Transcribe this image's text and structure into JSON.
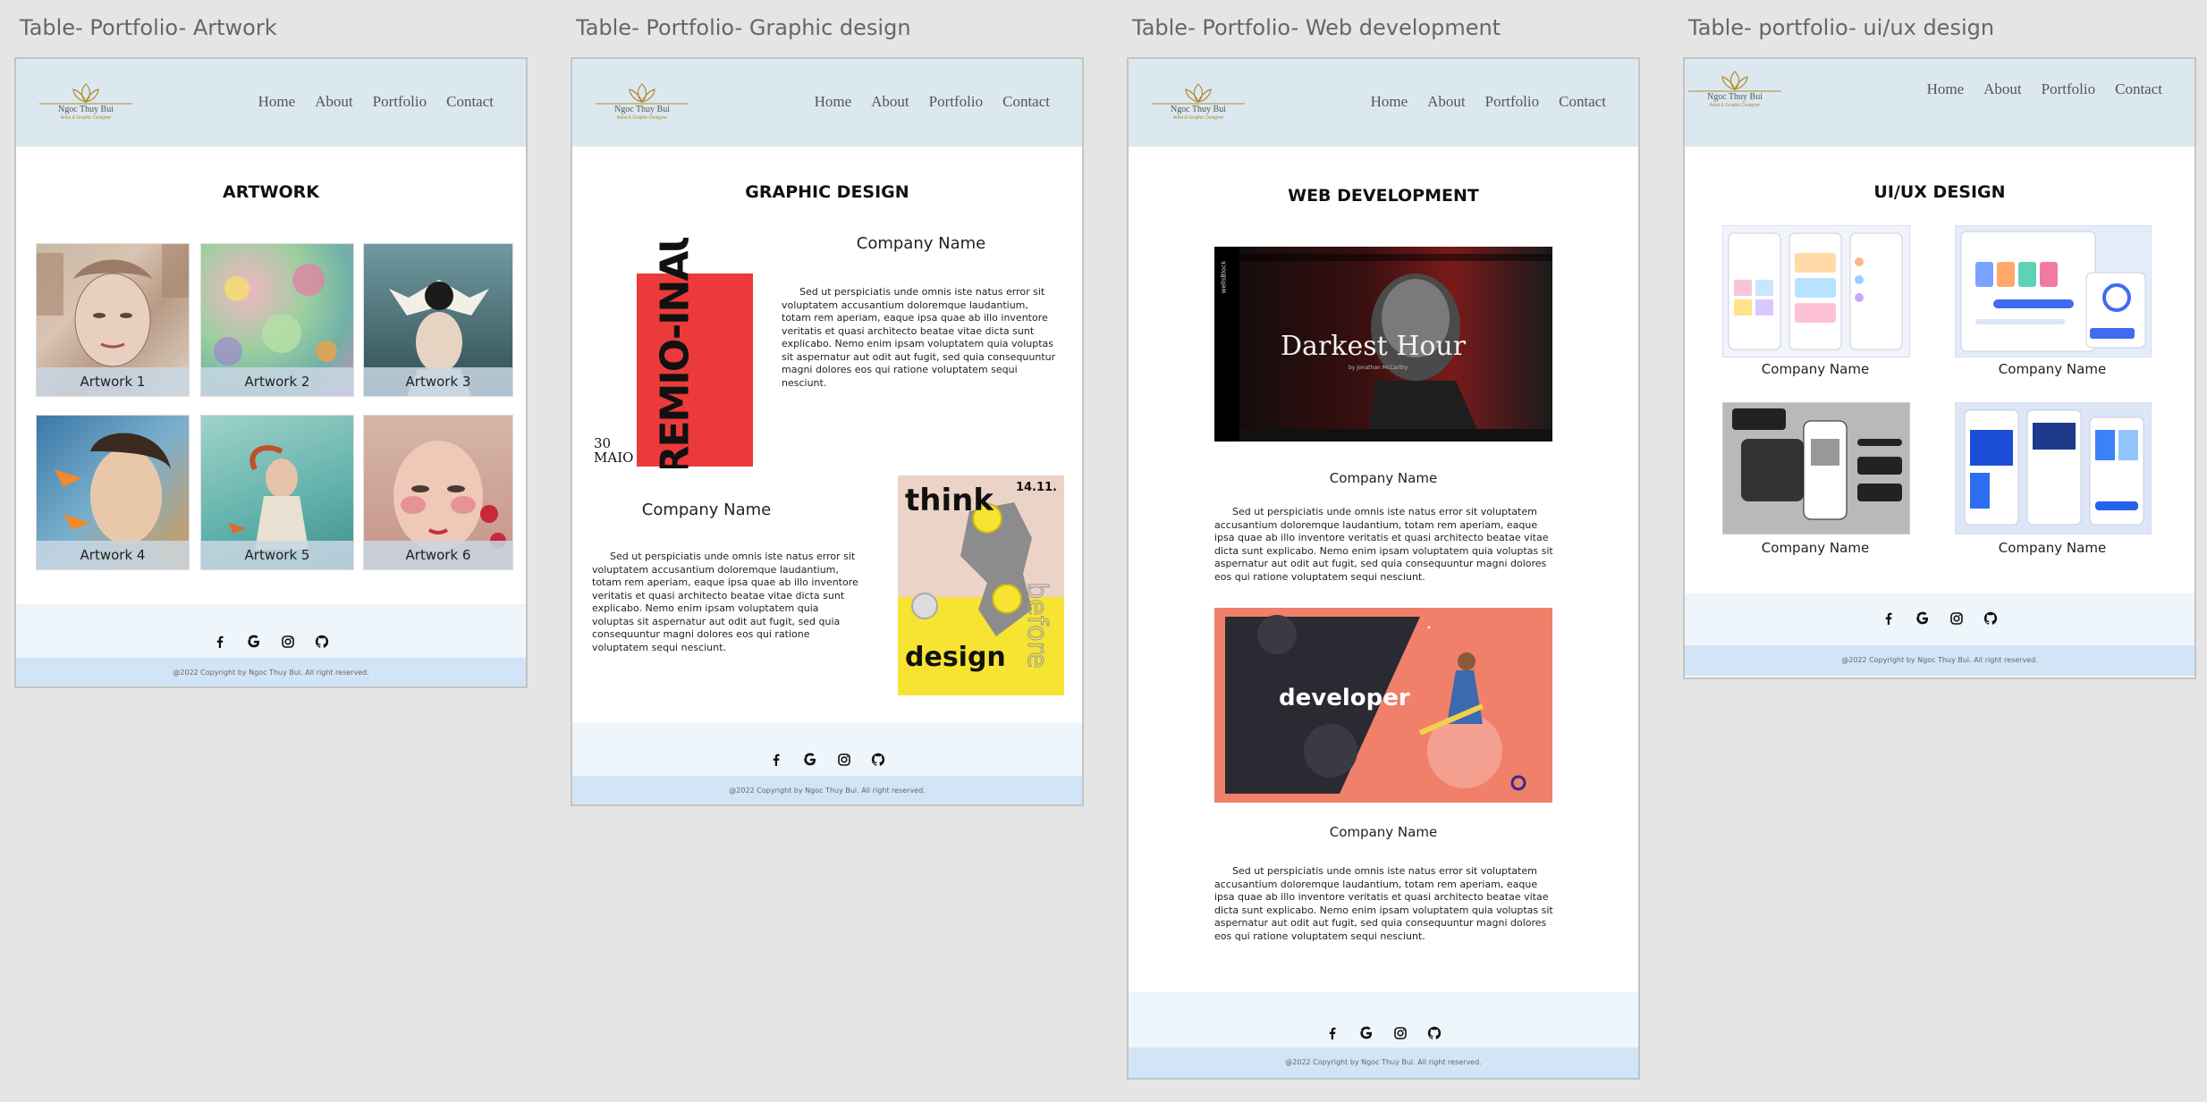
{
  "nav": [
    "Home",
    "About",
    "Portfolio",
    "Contact"
  ],
  "logo": {
    "name": "Ngoc Thuy Bui",
    "tagline": "Artist & Graphic Designer"
  },
  "copyright": "@2022 Copyright by Ngoc Thuy Bui. All right reserved.",
  "social_icons": [
    "facebook-icon",
    "google-icon",
    "instagram-icon",
    "github-icon"
  ],
  "colors": {
    "header_bg": "#dce8f0",
    "footer_bg": "#eef5fb",
    "copyright_bg": "#d2e5f6",
    "canvas_bg": "#e5e5e5"
  },
  "paragraph": "Sed ut perspiciatis unde omnis iste natus error sit voluptatem accusantium doloremque laudantium, totam rem aperiam, eaque ipsa quae ab illo inventore veritatis et quasi architecto beatae vitae dicta sunt explicabo. Nemo enim ipsam voluptatem quia voluptas sit aspernatur aut odit aut fugit, sed quia consequuntur magni dolores eos qui ratione voluptatem sequi nesciunt.",
  "frames": {
    "artwork": {
      "label": "Table- Portfolio- Artwork",
      "heading": "ARTWORK",
      "items": [
        "Artwork 1",
        "Artwork 2",
        "Artwork 3",
        "Artwork 4",
        "Artwork 5",
        "Artwork 6"
      ]
    },
    "graphic": {
      "label": "Table- Portfolio- Graphic design",
      "heading": "GRAPHIC DESIGN",
      "company1": "Company Name",
      "company2": "Company Name",
      "poster1": {
        "text": "GREMIO-INAUGURA",
        "date": "30 MAIO"
      },
      "poster2": {
        "top": "think",
        "bottom": "design",
        "side": "before",
        "date": "14.11."
      }
    },
    "web": {
      "label": "Table- Portfolio- Web development",
      "heading": "WEB DEVELOPMENT",
      "company1": "Company Name",
      "company2": "Company Name",
      "shot1": {
        "title": "Darkest Hour",
        "subtitle": "by Jonathan McCarthy",
        "side": "wellsBlock"
      },
      "shot2": {
        "title": "developer"
      }
    },
    "uiux": {
      "label": "Table- portfolio- ui/ux design",
      "heading": "UI/UX DESIGN",
      "items": [
        "Company Name",
        "Company Name",
        "Company Name",
        "Company Name"
      ]
    }
  }
}
